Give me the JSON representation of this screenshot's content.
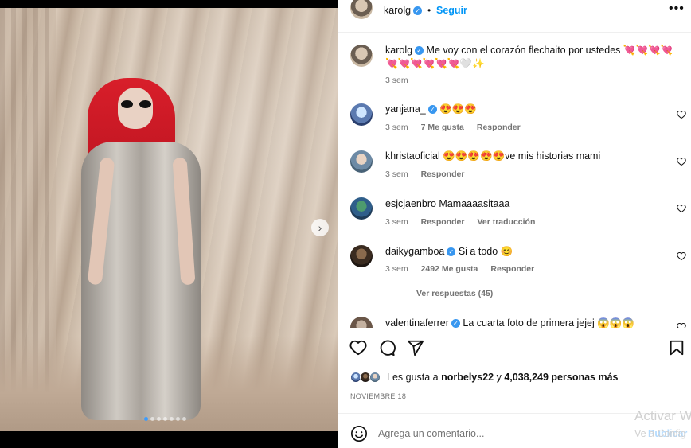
{
  "post": {
    "author": "karolg",
    "follow_label": "Seguir",
    "dot": "•",
    "more_icon": "more-horizontal-icon",
    "caption": "Me voy con el corazón flechaito por ustedes 💘💘💘💘💘💘💘💘💘💘🤍✨",
    "caption_time": "3 sem",
    "photo_next": "›",
    "carousel_count": 7,
    "carousel_active": 0
  },
  "comments": [
    {
      "user": "yanjana_",
      "verified": true,
      "text": "😍😍😍",
      "time": "3 sem",
      "likes": "7 Me gusta",
      "reply": "Responder",
      "translate": ""
    },
    {
      "user": "khristaoficial",
      "verified": false,
      "text": "😍😍😍😍😍ve mis historias mami",
      "time": "3 sem",
      "likes": "",
      "reply": "Responder",
      "translate": ""
    },
    {
      "user": "esjcjaenbro",
      "verified": false,
      "text": "Mamaaaasitaaa",
      "time": "3 sem",
      "likes": "",
      "reply": "Responder",
      "translate": "Ver traducción"
    },
    {
      "user": "daikygamboa",
      "verified": true,
      "text": "Si a todo 😊",
      "time": "3 sem",
      "likes": "2492 Me gusta",
      "reply": "Responder",
      "translate": ""
    },
    {
      "user": "valentinaferrer",
      "verified": true,
      "text": "La cuarta foto de primera jejej 😱😱😱",
      "time": "",
      "likes": "",
      "reply": "",
      "translate": ""
    }
  ],
  "view_replies": "Ver respuestas (45)",
  "likes": {
    "prefix": "Les gusta a ",
    "user": "norbelys22",
    "middle": " y ",
    "count": "4,038,249 personas más"
  },
  "date": "NOVIEMBRE 18",
  "comment_input": {
    "placeholder": "Agrega un comentario...",
    "publish": "Publicar"
  },
  "watermark": {
    "line1": "Activar W",
    "line2": "Ve a Config"
  },
  "verified_glyph": "✓"
}
